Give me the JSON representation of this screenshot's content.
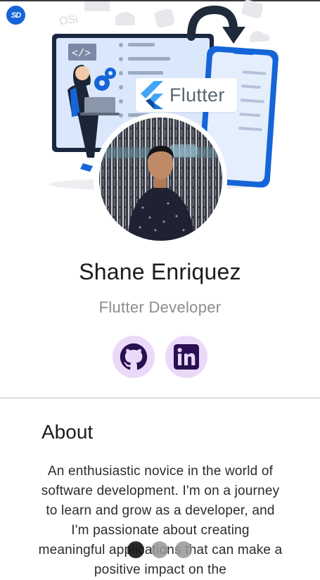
{
  "app": {
    "logo_text": "SD"
  },
  "hero": {
    "flutter_label": "Flutter",
    "code_tag": "</>",
    "os_label": "OSi"
  },
  "profile": {
    "name": "Shane Enriquez",
    "role": "Flutter Developer"
  },
  "social": [
    {
      "icon": "github-icon"
    },
    {
      "icon": "linkedin-icon"
    }
  ],
  "about": {
    "title": "About",
    "text": "An enthusiastic novice in the world of software development. I'm on a journey to learn and grow as a developer, and I'm passionate about creating meaningful applications that can make a positive impact on the"
  },
  "pager": {
    "count": 3,
    "active": 1
  },
  "colors": {
    "accent": "#1565d8",
    "social_bg": "#ead9f8",
    "flutter_blue": "#42a5f5"
  }
}
